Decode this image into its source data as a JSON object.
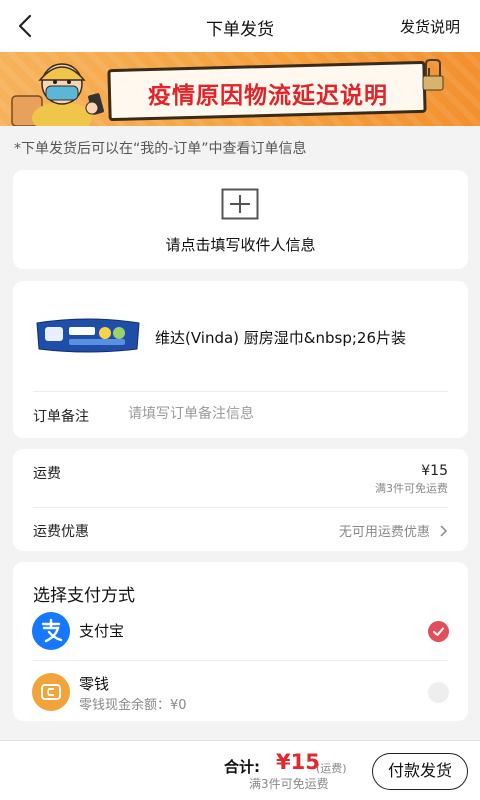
{
  "header": {
    "title": "下单发货",
    "right_link": "发货说明"
  },
  "banner": {
    "text": "疫情原因物流延迟说明"
  },
  "notice": "*下单发货后可以在“我的-订单”中查看订单信息",
  "recipient": {
    "prompt": "请点击填写收件人信息"
  },
  "product": {
    "name": "维达(Vinda) 厨房湿巾&nbsp;26片装"
  },
  "remark": {
    "label": "订单备注",
    "placeholder": "请填写订单备注信息",
    "value": ""
  },
  "shipping": {
    "label": "运费",
    "price": "¥15",
    "hint": "满3件可免运费",
    "discount_label": "运费优惠",
    "discount_value": "无可用运费优惠"
  },
  "payment": {
    "title": "选择支付方式",
    "methods": [
      {
        "label": "支付宝",
        "selected": true
      },
      {
        "label": "零钱",
        "balance": "零钱现金余额：¥0",
        "selected": false
      }
    ]
  },
  "footer": {
    "total_label": "合计:",
    "total_amount": "¥15",
    "total_note": "(运费)",
    "total_hint": "满3件可免运费",
    "pay_button": "付款发货"
  },
  "colors": {
    "accent_red": "#e0282e",
    "check_selected": "#e0505a",
    "alipay_blue": "#1677ff",
    "wallet_orange": "#f2a33a",
    "banner_orange": "#f5a23f"
  }
}
